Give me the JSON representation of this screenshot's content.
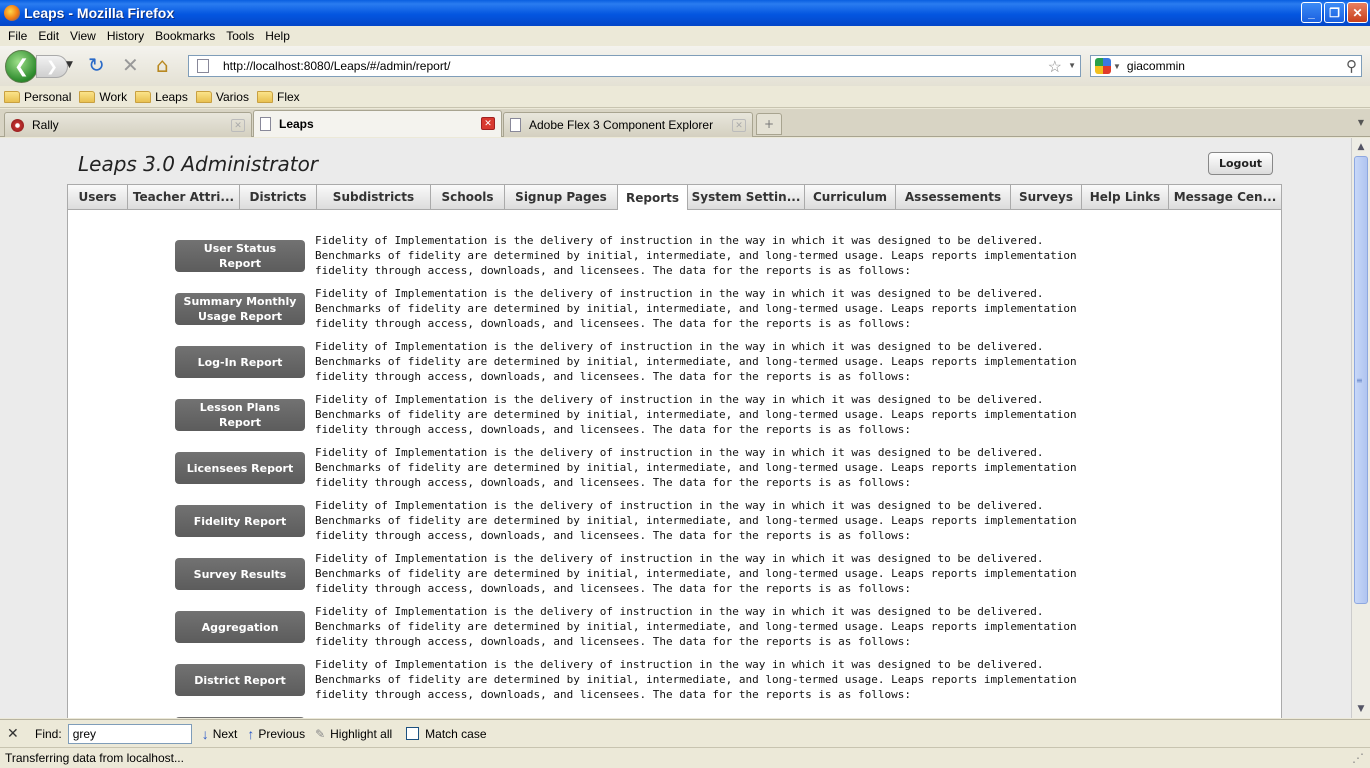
{
  "window": {
    "title": "Leaps - Mozilla Firefox"
  },
  "menu": [
    "File",
    "Edit",
    "View",
    "History",
    "Bookmarks",
    "Tools",
    "Help"
  ],
  "address": {
    "url": "http://localhost:8080/Leaps/#/admin/report/"
  },
  "search": {
    "value": "giacommin"
  },
  "bookmarks": [
    "Personal",
    "Work",
    "Leaps",
    "Varios",
    "Flex"
  ],
  "browser_tabs": [
    {
      "label": "Rally"
    },
    {
      "label": "Leaps"
    },
    {
      "label": "Adobe Flex 3 Component Explorer"
    }
  ],
  "app": {
    "title": "Leaps 3.0 Administrator",
    "logout_label": "Logout",
    "tabs": [
      "Users",
      "Teacher Attri...",
      "Districts",
      "Subdistricts",
      "Schools",
      "Signup Pages",
      "Reports",
      "System Settin...",
      "Curriculum",
      "Assessements",
      "Surveys",
      "Help Links",
      "Message Cen..."
    ],
    "active_tab": "Reports"
  },
  "reports": [
    {
      "label": "User Status Report",
      "description": "Fidelity of Implementation is the delivery of instruction in the way in which it was designed to be delivered. Benchmarks of fidelity are determined by initial, intermediate, and long-termed usage.  Leaps reports implementation fidelity through access, downloads, and licensees. The data for the reports is as follows:"
    },
    {
      "label": "Summary Monthly Usage Report",
      "description": "Fidelity of Implementation is the delivery of instruction in the way in which it was designed to be delivered. Benchmarks of fidelity are determined by initial, intermediate, and long-termed usage.  Leaps reports implementation fidelity through access, downloads, and licensees. The data for the reports is as follows:"
    },
    {
      "label": "Log-In Report",
      "description": "Fidelity of Implementation is the delivery of instruction in the way in which it was designed to be delivered. Benchmarks of fidelity are determined by initial, intermediate, and long-termed usage.  Leaps reports implementation fidelity through access, downloads, and licensees. The data for the reports is as follows:"
    },
    {
      "label": "Lesson Plans Report",
      "description": "Fidelity of Implementation is the delivery of instruction in the way in which it was designed to be delivered. Benchmarks of fidelity are determined by initial, intermediate, and long-termed usage.  Leaps reports implementation fidelity through access, downloads, and licensees. The data for the reports is as follows:"
    },
    {
      "label": "Licensees Report",
      "description": "Fidelity of Implementation is the delivery of instruction in the way in which it was designed to be delivered. Benchmarks of fidelity are determined by initial, intermediate, and long-termed usage.  Leaps reports implementation fidelity through access, downloads, and licensees. The data for the reports is as follows:"
    },
    {
      "label": "Fidelity Report",
      "description": "Fidelity of Implementation is the delivery of instruction in the way in which it was designed to be delivered. Benchmarks of fidelity are determined by initial, intermediate, and long-termed usage.  Leaps reports implementation fidelity through access, downloads, and licensees. The data for the reports is as follows:"
    },
    {
      "label": "Survey Results",
      "description": "Fidelity of Implementation is the delivery of instruction in the way in which it was designed to be delivered. Benchmarks of fidelity are determined by initial, intermediate, and long-termed usage.  Leaps reports implementation fidelity through access, downloads, and licensees. The data for the reports is as follows:"
    },
    {
      "label": "Aggregation",
      "description": "Fidelity of Implementation is the delivery of instruction in the way in which it was designed to be delivered. Benchmarks of fidelity are determined by initial, intermediate, and long-termed usage.  Leaps reports implementation fidelity through access, downloads, and licensees. The data for the reports is as follows:"
    },
    {
      "label": "District Report",
      "description": "Fidelity of Implementation is the delivery of instruction in the way in which it was designed to be delivered. Benchmarks of fidelity are determined by initial, intermediate, and long-termed usage.  Leaps reports implementation fidelity through access, downloads, and licensees. The data for the reports is as follows:"
    }
  ],
  "findbar": {
    "label": "Find:",
    "value": "grey",
    "next_label": "Next",
    "previous_label": "Previous",
    "highlight_label": "Highlight all",
    "match_case_label": "Match case"
  },
  "status": {
    "text": "Transferring data from localhost..."
  },
  "colors": {
    "titlebar": "#0456e0",
    "report_button": "#666666",
    "panel": "#ffffff"
  }
}
